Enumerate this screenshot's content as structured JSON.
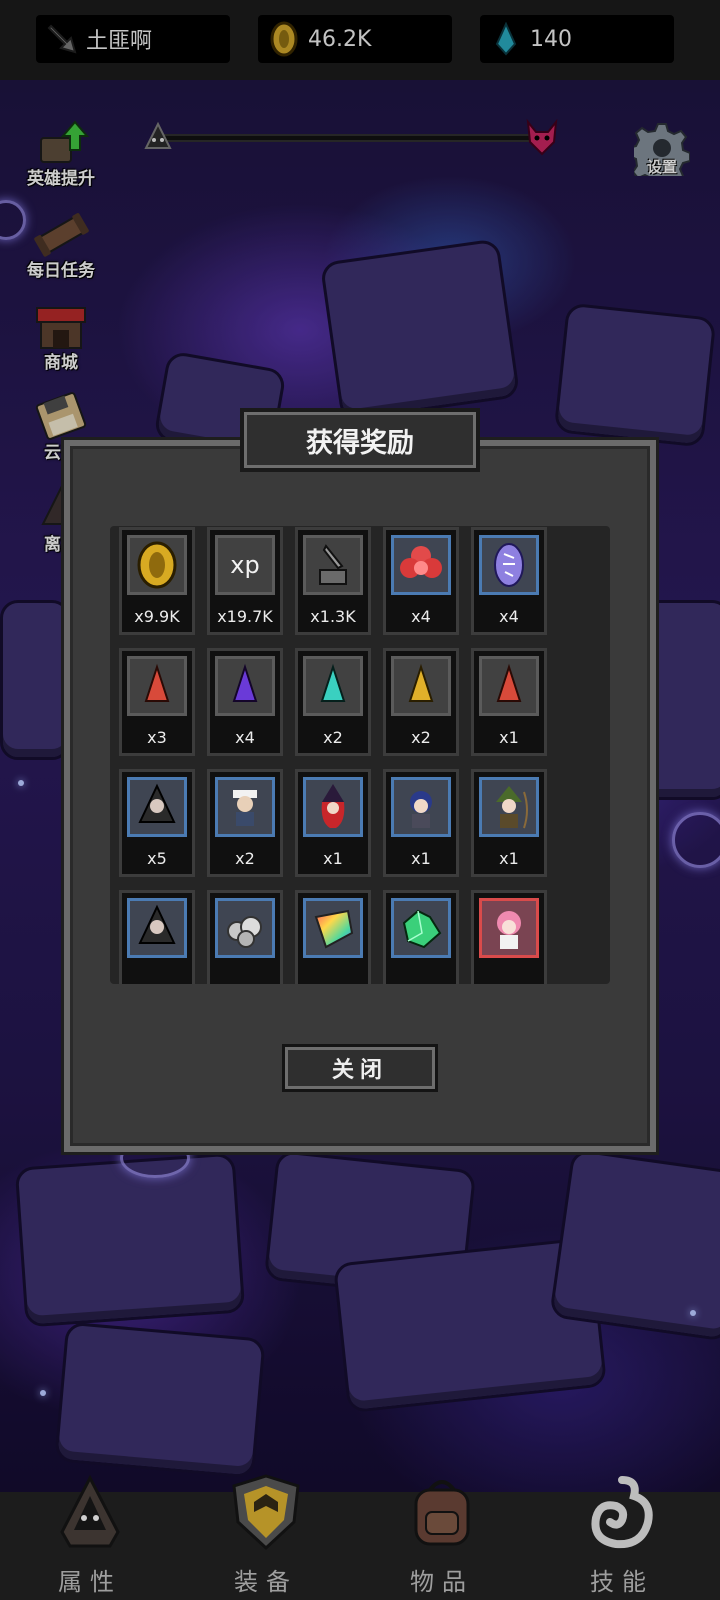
{
  "topbar": {
    "player_name": "土匪啊",
    "gold": "46.2K",
    "gems": "140",
    "icons": [
      "sword-icon",
      "gold-coin-icon",
      "blue-gem-icon"
    ]
  },
  "side_menu": [
    {
      "label": "英雄提升",
      "icon": "hero-upgrade-icon"
    },
    {
      "label": "每日任务",
      "icon": "daily-task-icon"
    },
    {
      "label": "商城",
      "icon": "shop-icon"
    },
    {
      "label": "云存",
      "icon": "cloud-save-icon"
    },
    {
      "label": "离线",
      "icon": "offline-reward-icon"
    }
  ],
  "settings": {
    "label": "设置",
    "icon": "gear-icon"
  },
  "modal": {
    "title": "获得奖励",
    "close_label": "关闭",
    "rewards": [
      {
        "icon": "gold-coin-icon",
        "qty": "x9.9K",
        "frame": "gray"
      },
      {
        "icon": "xp-icon",
        "qty": "x19.7K",
        "frame": "gray"
      },
      {
        "icon": "sword-stone-icon",
        "qty": "x1.3K",
        "frame": "gray"
      },
      {
        "icon": "red-flower-icon",
        "qty": "x4",
        "frame": "blue"
      },
      {
        "icon": "rune-stone-icon",
        "qty": "x4",
        "frame": "blue"
      },
      {
        "icon": "red-crystal-icon",
        "qty": "x3",
        "frame": "gray"
      },
      {
        "icon": "purple-crystal-icon",
        "qty": "x4",
        "frame": "gray"
      },
      {
        "icon": "cyan-crystal-icon",
        "qty": "x2",
        "frame": "gray"
      },
      {
        "icon": "yellow-crystal-icon",
        "qty": "x2",
        "frame": "gray"
      },
      {
        "icon": "red-crystal-icon",
        "qty": "x1",
        "frame": "gray"
      },
      {
        "icon": "hooded-assassin-hero-icon",
        "qty": "x5",
        "frame": "blue"
      },
      {
        "icon": "sailor-hero-icon",
        "qty": "x2",
        "frame": "blue"
      },
      {
        "icon": "witch-hero-icon",
        "qty": "x1",
        "frame": "blue"
      },
      {
        "icon": "blue-hair-hero-icon",
        "qty": "x1",
        "frame": "blue"
      },
      {
        "icon": "archer-hero-icon",
        "qty": "x1",
        "frame": "blue"
      },
      {
        "icon": "hooded-assassin-hero-icon",
        "qty": "",
        "frame": "blue"
      },
      {
        "icon": "silver-ore-icon",
        "qty": "",
        "frame": "blue"
      },
      {
        "icon": "rainbow-crystal-icon",
        "qty": "",
        "frame": "blue"
      },
      {
        "icon": "green-crystal-icon",
        "qty": "",
        "frame": "blue"
      },
      {
        "icon": "pink-hair-hero-icon",
        "qty": "",
        "frame": "red"
      }
    ]
  },
  "bottom_nav": [
    {
      "label": "属性",
      "icon": "hood-icon"
    },
    {
      "label": "装备",
      "icon": "shield-icon"
    },
    {
      "label": "物品",
      "icon": "backpack-icon"
    },
    {
      "label": "技能",
      "icon": "swirl-icon"
    }
  ],
  "colors": {
    "topbar_bg": "#1b1b1b",
    "panel_bg": "#3a3a3a",
    "frame_blue": "#4b7bb3",
    "frame_red": "#d94b4b",
    "bg_purple": "#2a1a5c"
  }
}
